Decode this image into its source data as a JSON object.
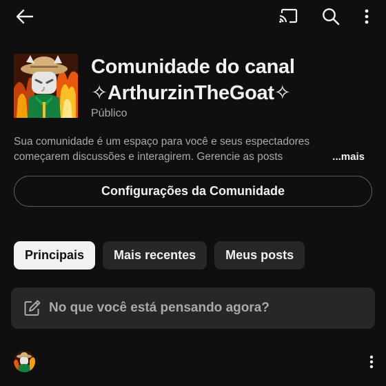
{
  "topbar": {
    "back_icon": "arrow-left-icon",
    "cast_icon": "cast-icon",
    "search_icon": "search-icon",
    "more_icon": "more-vertical-icon"
  },
  "community": {
    "title_line1": "Comunidade do canal",
    "title_line2": "✧ArthurzinTheGoat✧",
    "privacy": "Público",
    "description_line1": "Sua comunidade é um espaço para você e seus espectadores",
    "description_line2": "começarem discussões e interagirem. Gerencie as posts",
    "more_label": "...mais",
    "settings_button": "Configurações da Comunidade"
  },
  "tabs": [
    {
      "label": "Principais",
      "active": true
    },
    {
      "label": "Mais recentes",
      "active": false
    },
    {
      "label": "Meus posts",
      "active": false
    }
  ],
  "composer": {
    "icon": "edit-icon",
    "placeholder": "No que você está pensando agora?"
  },
  "post": {
    "avatar": "channel-avatar",
    "more_icon": "more-vertical-icon"
  },
  "colors": {
    "background": "#0f0f0f",
    "surface": "#272727",
    "text_primary": "#f1f1f1",
    "text_secondary": "#aaaaaa",
    "outline": "#5a5a5a"
  }
}
